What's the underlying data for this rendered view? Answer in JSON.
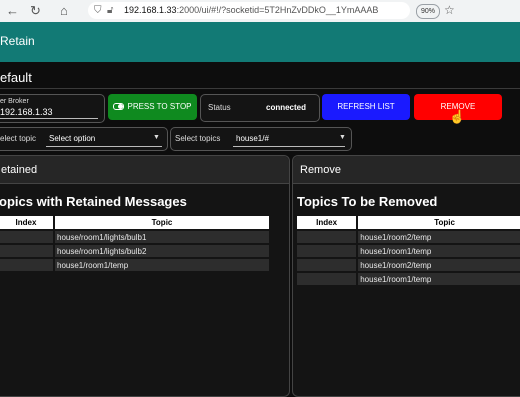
{
  "browser": {
    "url_host": "192.168.1.33",
    "url_rest": ":2000/ui/#!/?socketid=5T2HnZvDDkO__1YmAAAB",
    "zoom": "90%"
  },
  "app": {
    "title": "Retain"
  },
  "group": {
    "title": "efault"
  },
  "broker": {
    "label": "er Broker",
    "value": "192.168.1.33"
  },
  "buttons": {
    "stop": "PRESS TO STOP",
    "refresh": "REFRESH LIST",
    "remove": "REMOVE"
  },
  "status": {
    "label": "Status",
    "value": "connected"
  },
  "select1": {
    "label": "elect topic",
    "value": "Select option"
  },
  "select2": {
    "label": "Select topics",
    "value": "house1/#"
  },
  "left_panel": {
    "header": "etained",
    "heading": "opics with Retained Messages",
    "columns": [
      "Index",
      "Topic"
    ],
    "rows": [
      [
        "",
        "house/room1/lights/bulb1"
      ],
      [
        "",
        "house/room1/lights/bulb2"
      ],
      [
        "",
        "house1/room1/temp"
      ]
    ]
  },
  "right_panel": {
    "header": "Remove",
    "heading": "Topics To be Removed",
    "columns": [
      "Index",
      "Topic"
    ],
    "rows": [
      [
        "",
        "house1/room2/temp"
      ],
      [
        "",
        "house1/room1/temp"
      ],
      [
        "",
        "house1/room2/temp"
      ],
      [
        "",
        "house1/room1/temp"
      ]
    ]
  },
  "colors": {
    "header_teal": "#127a75",
    "stop_green": "#0f8a1f",
    "refresh_blue": "#1a1aff",
    "remove_red": "#ff0000"
  }
}
